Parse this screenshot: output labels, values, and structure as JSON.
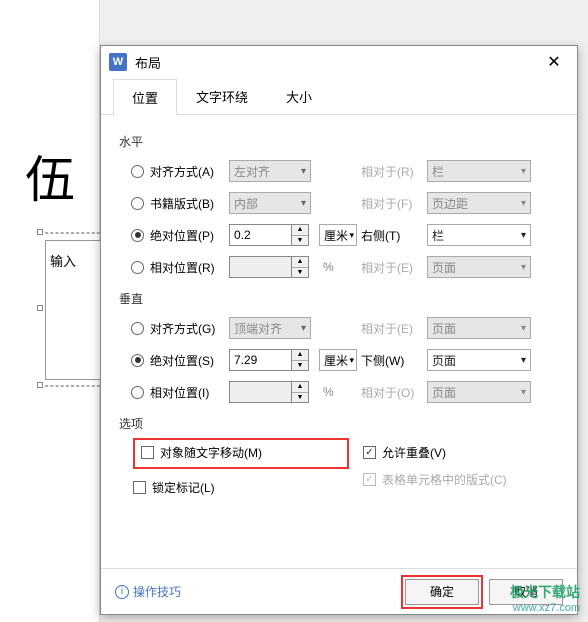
{
  "page": {
    "big_char": "伍",
    "input_text": "输入"
  },
  "dialog": {
    "title": "布局",
    "tabs": {
      "position": "位置",
      "wrap": "文字环绕",
      "size": "大小"
    },
    "horizontal": {
      "label": "水平",
      "align": {
        "label": "对齐方式(A)",
        "value": "左对齐",
        "rel_label": "相对于(R)",
        "rel_value": "栏"
      },
      "book": {
        "label": "书籍版式(B)",
        "value": "内部",
        "rel_label": "相对于(F)",
        "rel_value": "页边距"
      },
      "abs": {
        "label": "绝对位置(P)",
        "value": "0.2",
        "unit": "厘米",
        "side_label": "右侧(T)",
        "side_value": "栏"
      },
      "rel": {
        "label": "相对位置(R)",
        "value": "",
        "unit": "%",
        "rel_label": "相对于(E)",
        "rel_value": "页面"
      }
    },
    "vertical": {
      "label": "垂直",
      "align": {
        "label": "对齐方式(G)",
        "value": "顶端对齐",
        "rel_label": "相对于(E)",
        "rel_value": "页面"
      },
      "abs": {
        "label": "绝对位置(S)",
        "value": "7.29",
        "unit": "厘米",
        "side_label": "下侧(W)",
        "side_value": "页面"
      },
      "rel": {
        "label": "相对位置(I)",
        "value": "",
        "unit": "%",
        "rel_label": "相对于(O)",
        "rel_value": "页面"
      }
    },
    "options": {
      "label": "选项",
      "move_with_text": "对象随文字移动(M)",
      "lock_anchor": "锁定标记(L)",
      "allow_overlap": "允许重叠(V)",
      "table_layout": "表格单元格中的版式(C)"
    },
    "footer": {
      "help": "操作技巧",
      "ok": "确定",
      "cancel": "取消"
    }
  },
  "watermark": {
    "line1": "极光下载站",
    "line2": "www.xz7.com"
  }
}
